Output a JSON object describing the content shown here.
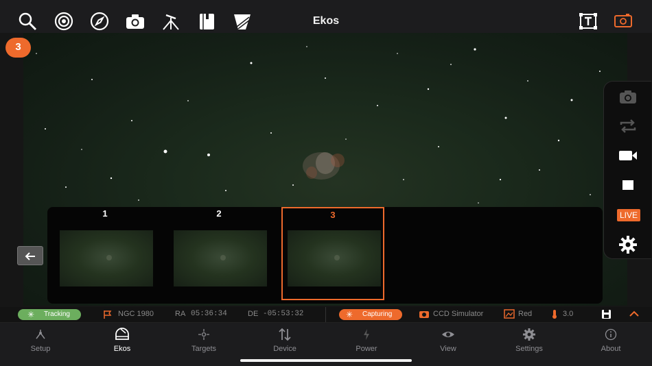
{
  "app_title": "Ekos",
  "colors": {
    "accent": "#ee6a2c",
    "tracking": "#6cae5e",
    "topbar": "#1c1c1e"
  },
  "toolbar": {
    "tools": [
      "search-icon",
      "target-icon",
      "compass-icon",
      "camera-icon",
      "tripod-icon",
      "catalog-icon",
      "filter-icon"
    ],
    "right_tools": [
      "text-frame-icon",
      "frame-icon"
    ]
  },
  "capture_count": "3",
  "controls": {
    "live_label": "LIVE",
    "items": [
      "camera-icon",
      "loop-icon",
      "video-icon",
      "stop-icon",
      "live-badge",
      "settings-icon"
    ]
  },
  "thumbnails": [
    {
      "label": "1",
      "selected": false
    },
    {
      "label": "2",
      "selected": false
    },
    {
      "label": "3",
      "selected": true
    }
  ],
  "status": {
    "tracking": "Tracking",
    "target": "NGC 1980",
    "ra_label": "RA",
    "ra_value": "05:36:34",
    "de_label": "DE",
    "de_value": "-05:53:32",
    "capture_state": "Capturing",
    "camera": "CCD Simulator",
    "filter": "Red",
    "temperature": "3.0"
  },
  "tabs": [
    {
      "label": "Setup",
      "icon": "setup-icon",
      "active": false
    },
    {
      "label": "Ekos",
      "icon": "ekos-icon",
      "active": true
    },
    {
      "label": "Targets",
      "icon": "targets-icon",
      "active": false
    },
    {
      "label": "Device",
      "icon": "device-icon",
      "active": false
    },
    {
      "label": "Power",
      "icon": "power-icon",
      "active": false
    },
    {
      "label": "View",
      "icon": "view-icon",
      "active": false
    },
    {
      "label": "Settings",
      "icon": "settings-icon",
      "active": false
    },
    {
      "label": "About",
      "icon": "about-icon",
      "active": false
    }
  ]
}
